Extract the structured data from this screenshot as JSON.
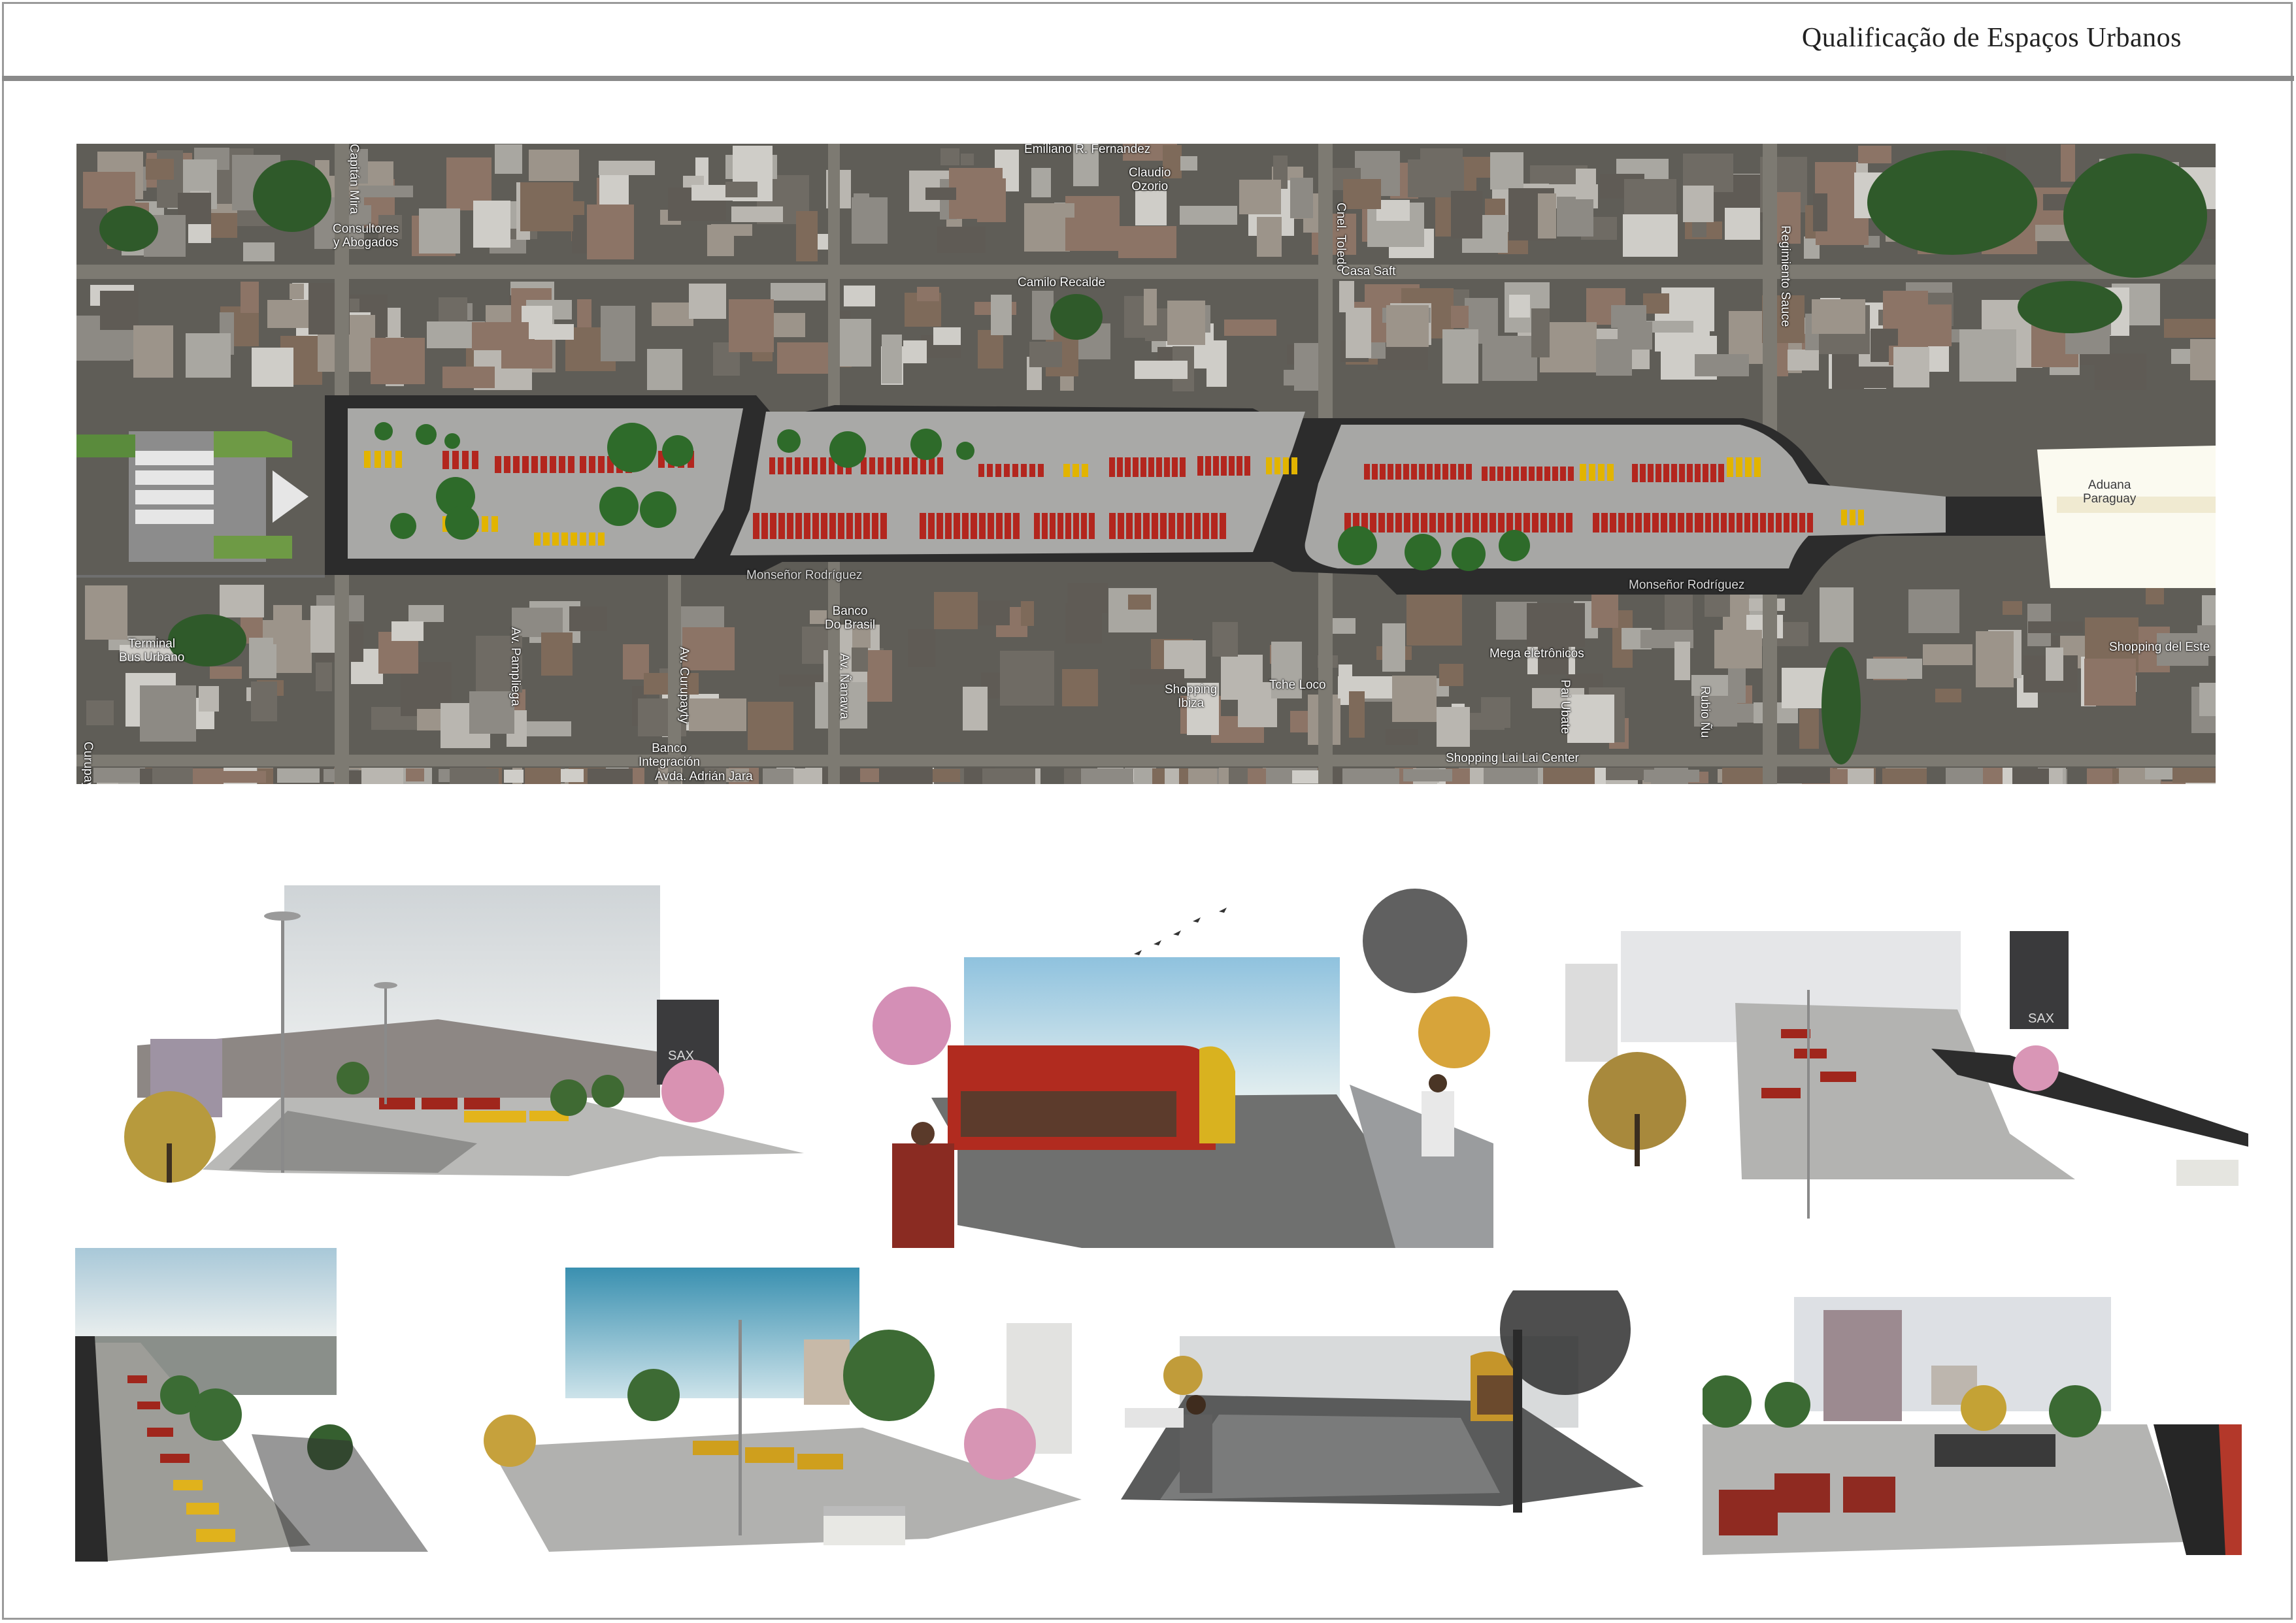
{
  "header": {
    "title": "Qualificação de Espaços Urbanos"
  },
  "site_plan": {
    "map_labels": {
      "emiliano": "Emiliano R. Fernandez",
      "claudio": "Claudio\nOzorio",
      "consultores": "Consultores\ny Abogados",
      "capitan": "Capitán Mira",
      "cnel_toledo": "Cnel. Toledo",
      "casa_saft": "Casa Saft",
      "camilo": "Camilo Recalde",
      "regimiento": "Regimiento Sauce",
      "aduana": "Aduana\nParaguay",
      "terminal": "Terminal\nBus Urbano",
      "av_pampliega": "Av. Pampliega",
      "av_curupayty": "Av. Curupayty",
      "banco_brasil": "Banco\nDo Brasil",
      "av_nanawa": "Av. Ñanawa",
      "banco_integracion": "Banco\nIntegración",
      "avda_adrian": "Avda. Adrián Jara",
      "monsenor_1": "Monseñor Rodríguez",
      "monsenor_2": "Monseñor Rodríguez",
      "shopping_ibiza": "Shopping\nIbiza",
      "tche_loco": "Tche Loco",
      "mega": "Mega eletrônicos",
      "shopping_lai": "Shopping Lai Lai Center",
      "rubio": "Rubio Ñu",
      "pai_ubate": "Pai Ubate",
      "shopping_este": "Shopping del Este",
      "curupayty_left": "Curupayty"
    },
    "colors": {
      "road": "#3c3c3c",
      "plaza": "#a9a9a7",
      "kiosk": "#b3261e",
      "bus": "#e2b400",
      "tree": "#2e6b2a",
      "aduana": "#fbfaf0"
    }
  },
  "renders": {
    "panel_1": {
      "sign": "SAX"
    },
    "panel_2": {
      "sign": ""
    },
    "panel_3": {
      "sign": "SAX"
    }
  }
}
